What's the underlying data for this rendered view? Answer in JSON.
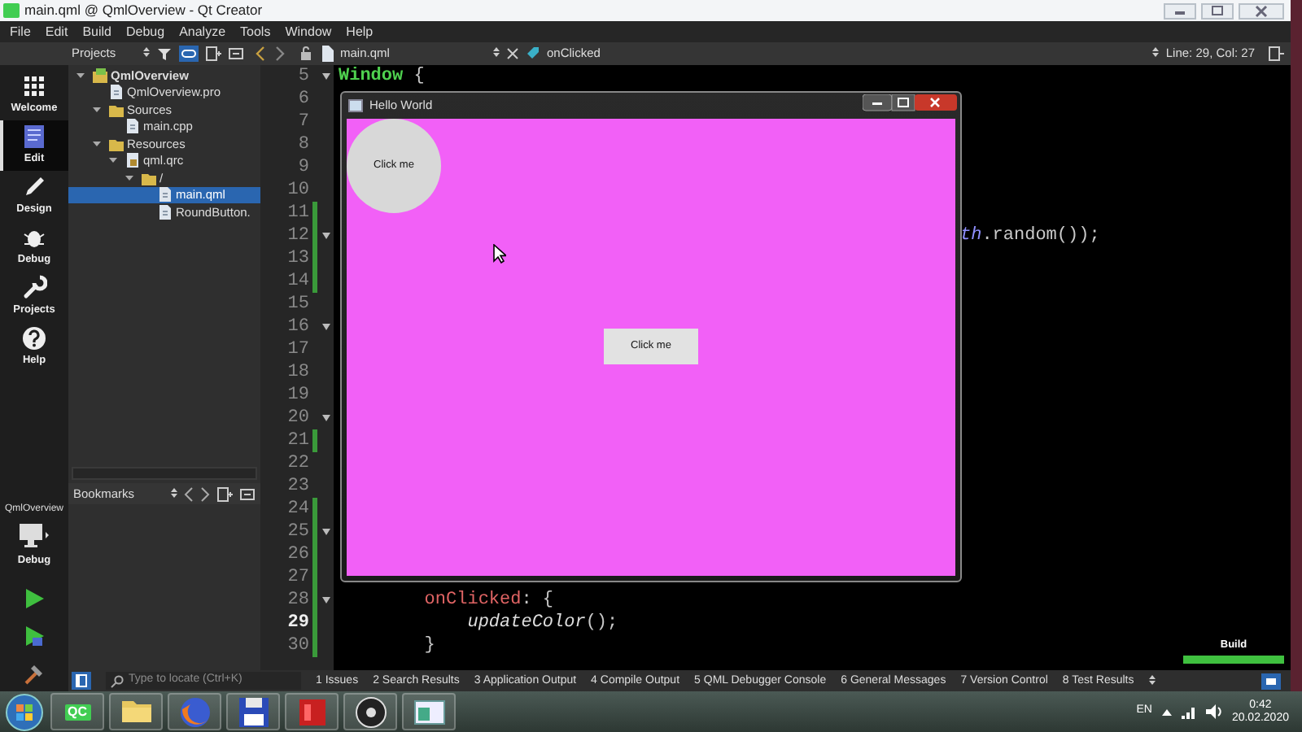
{
  "window": {
    "title": "main.qml @ QmlOverview - Qt Creator"
  },
  "menu": [
    "File",
    "Edit",
    "Build",
    "Debug",
    "Analyze",
    "Tools",
    "Window",
    "Help"
  ],
  "toolbar": {
    "project_selector": "Projects",
    "open_file": "main.qml",
    "symbol": "onClicked",
    "cursor_position": "Line: 29, Col: 27"
  },
  "modes": [
    {
      "label": "Welcome",
      "kind": "welcome",
      "selected": false
    },
    {
      "label": "Edit",
      "kind": "edit",
      "selected": true
    },
    {
      "label": "Design",
      "kind": "design",
      "selected": false
    },
    {
      "label": "Debug",
      "kind": "debug",
      "selected": false
    },
    {
      "label": "Projects",
      "kind": "projects",
      "selected": false
    },
    {
      "label": "Help",
      "kind": "help",
      "selected": false
    }
  ],
  "run_target": {
    "project": "QmlOverview",
    "config": "Debug"
  },
  "project_tree": [
    {
      "label": "QmlOverview",
      "kind": "project",
      "expanded": true,
      "selected": false,
      "children": [
        {
          "label": "QmlOverview.pro",
          "kind": "file",
          "selected": false
        },
        {
          "label": "Sources",
          "kind": "folder",
          "expanded": true,
          "selected": false,
          "children": [
            {
              "label": "main.cpp",
              "kind": "file",
              "selected": false
            }
          ]
        },
        {
          "label": "Resources",
          "kind": "folder",
          "expanded": true,
          "selected": false,
          "children": [
            {
              "label": "qml.qrc",
              "kind": "resource",
              "expanded": true,
              "selected": false,
              "children": [
                {
                  "label": "/",
                  "kind": "folder",
                  "expanded": true,
                  "selected": false,
                  "children": [
                    {
                      "label": "main.qml",
                      "kind": "file",
                      "selected": true
                    },
                    {
                      "label": "RoundButton.",
                      "kind": "file",
                      "selected": false
                    }
                  ]
                }
              ]
            }
          ]
        }
      ]
    }
  ],
  "bookmarks": {
    "title": "Bookmarks"
  },
  "editor": {
    "lines": [
      {
        "number": "5",
        "fold": true,
        "changed": false,
        "current": false,
        "tokens": [
          {
            "kind": "type",
            "text": "Window"
          },
          {
            "kind": "plain",
            "text": " {"
          }
        ]
      },
      {
        "number": "6",
        "fold": false,
        "changed": false,
        "current": false
      },
      {
        "number": "7",
        "fold": false,
        "changed": false,
        "current": false
      },
      {
        "number": "8",
        "fold": false,
        "changed": false,
        "current": false
      },
      {
        "number": "9",
        "fold": false,
        "changed": false,
        "current": false
      },
      {
        "number": "10",
        "fold": false,
        "changed": false,
        "current": false
      },
      {
        "number": "11",
        "fold": false,
        "changed": true,
        "current": false
      },
      {
        "number": "12",
        "fold": true,
        "changed": true,
        "current": false,
        "covered": true,
        "tokens": [
          {
            "kind": "member",
            "text": "th"
          },
          {
            "kind": "plain",
            "text": ".random());"
          }
        ]
      },
      {
        "number": "13",
        "fold": false,
        "changed": true,
        "current": false
      },
      {
        "number": "14",
        "fold": false,
        "changed": true,
        "current": false
      },
      {
        "number": "15",
        "fold": false,
        "changed": false,
        "current": false
      },
      {
        "number": "16",
        "fold": true,
        "changed": false,
        "current": false
      },
      {
        "number": "17",
        "fold": false,
        "changed": false,
        "current": false
      },
      {
        "number": "18",
        "fold": false,
        "changed": false,
        "current": false
      },
      {
        "number": "19",
        "fold": false,
        "changed": false,
        "current": false
      },
      {
        "number": "20",
        "fold": true,
        "changed": false,
        "current": false
      },
      {
        "number": "21",
        "fold": false,
        "changed": true,
        "current": false
      },
      {
        "number": "22",
        "fold": false,
        "changed": false,
        "current": false
      },
      {
        "number": "23",
        "fold": false,
        "changed": false,
        "current": false
      },
      {
        "number": "24",
        "fold": false,
        "changed": true,
        "current": false
      },
      {
        "number": "25",
        "fold": true,
        "changed": true,
        "current": false
      },
      {
        "number": "26",
        "fold": false,
        "changed": true,
        "current": false
      },
      {
        "number": "27",
        "fold": false,
        "changed": true,
        "current": false
      },
      {
        "number": "28",
        "fold": true,
        "changed": true,
        "current": false,
        "tokens": [
          {
            "kind": "property",
            "text": "        onClicked"
          },
          {
            "kind": "plain",
            "text": ": {"
          }
        ]
      },
      {
        "number": "29",
        "fold": false,
        "changed": true,
        "current": true,
        "tokens": [
          {
            "kind": "call",
            "text": "            updateColor"
          },
          {
            "kind": "plain",
            "text": "();"
          }
        ]
      },
      {
        "number": "30",
        "fold": false,
        "changed": true,
        "current": false,
        "tokens": [
          {
            "kind": "plain",
            "text": "        }"
          }
        ]
      }
    ]
  },
  "app_window": {
    "title": "Hello World",
    "round_button": "Click me",
    "rect_button": "Click me"
  },
  "build_progress": {
    "label": "Build",
    "level": 1
  },
  "output_bar": {
    "search_placeholder": "Type to locate (Ctrl+K)",
    "tabs": [
      "1 Issues",
      "2 Search Results",
      "3 Application Output",
      "4 Compile Output",
      "5 QML Debugger Console",
      "6 General Messages",
      "7 Version Control",
      "8 Test Results"
    ]
  },
  "taskbar": {
    "apps": [
      {
        "kind": "qt",
        "label": "QC"
      },
      {
        "kind": "folder"
      },
      {
        "kind": "browser"
      },
      {
        "kind": "floppy"
      },
      {
        "kind": "red-app"
      },
      {
        "kind": "recorder"
      },
      {
        "kind": "window-app"
      }
    ],
    "language": "EN",
    "time": "0:42",
    "date": "20.02.2020"
  }
}
